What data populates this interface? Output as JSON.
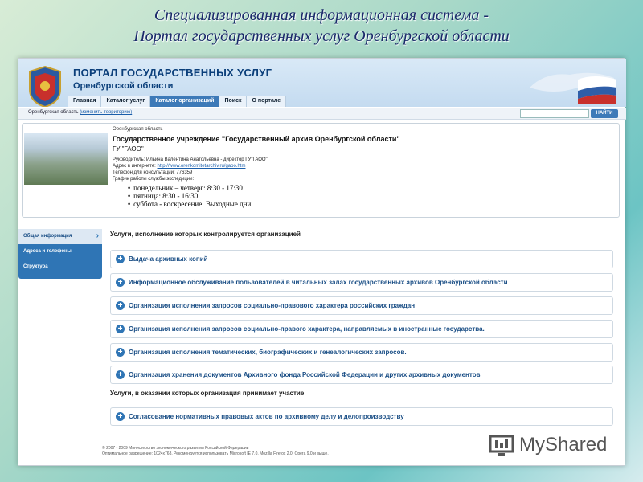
{
  "slide_title": {
    "line1": "Специализированная информационная система -",
    "line2": "Портал государственных услуг Оренбургской области"
  },
  "portal": {
    "title": "ПОРТАЛ ГОСУДАРСТВЕННЫХ УСЛУГ",
    "subtitle": "Оренбургской области"
  },
  "nav": [
    {
      "label": "Главная",
      "active": false
    },
    {
      "label": "Каталог услуг",
      "active": false
    },
    {
      "label": "Каталог организаций",
      "active": true
    },
    {
      "label": "Поиск",
      "active": false
    },
    {
      "label": "О портале",
      "active": false
    }
  ],
  "location": {
    "region": "Оренбургская область",
    "change": "(изменить территорию)"
  },
  "search": {
    "button": "НАЙТИ",
    "placeholder": ""
  },
  "org": {
    "region": "Оренбургская область",
    "name": "Государственное учреждение \"Государственный архив Оренбургской области\"",
    "short": "ГУ \"ГАОО\"",
    "head": "Руководитель: Ильина Валентина Анатольевна - директор ГУ\"ГАОО\"",
    "web_label": "Адрес в интернете:",
    "web_url": "http://www.orenkomitetarchiv.ru/gaoo.htm",
    "phone": "Телефон для консультаций: 776359",
    "schedule_label": "График работы службы экспедиции:",
    "schedule": [
      "понедельник – четверг: 8:30 - 17:30",
      "пятница: 8:30 - 16:30",
      "суббота - воскресение:  Выходные дни"
    ]
  },
  "sidebar": [
    {
      "label": "Общая информация",
      "active": true
    },
    {
      "label": "Адреса и телефоны",
      "active": false
    },
    {
      "label": "Структура",
      "active": false
    }
  ],
  "sections": {
    "controlled": "Услуги, исполнение которых контролируется организацией",
    "participates": "Услуги, в оказании которых организация принимает участие"
  },
  "services_controlled": [
    "Выдача архивных копий",
    "Информационное обслуживание пользователей в читальных залах государственных архивов Оренбургской области",
    "Организация исполнения запросов социально-правового характера российских граждан",
    "Организация исполнения запросов социально-правого характера, направляемых в иностранные государства.",
    "Организация исполнения тематических, биографических и генеалогических запросов.",
    "Организация хранения документов Архивного фонда Российской Федерации и других архивных документов"
  ],
  "services_participates": [
    "Согласование нормативных правовых актов по архивному делу и делопроизводству"
  ],
  "footer": {
    "line1": "© 2007 - 2009 Министерство экономического развития Российской Федерации",
    "line2": "Оптимальное разрешение: 1024x768. Рекомендуется использовать Microsoft IE 7.0, Mozilla Firefox 2.0, Opera 9.0 и выше."
  },
  "watermark": "MyShared"
}
